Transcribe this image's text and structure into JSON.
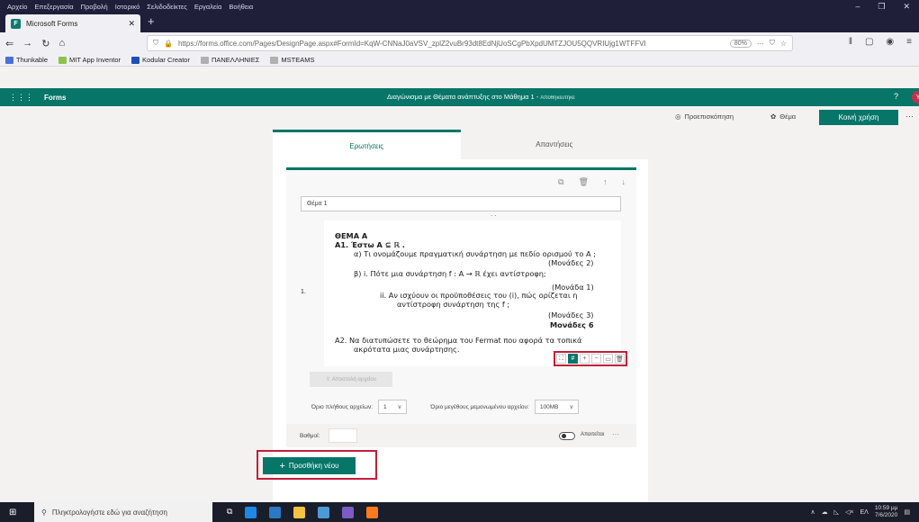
{
  "browser": {
    "menu": [
      "Αρχείο",
      "Επεξεργασία",
      "Προβολή",
      "Ιστορικό",
      "Σελιδοδείκτες",
      "Εργαλεία",
      "Βοήθεια"
    ],
    "tab_title": "Microsoft Forms",
    "url": "https://forms.office.com/Pages/DesignPage.aspx#FormId=KqW-CNNaJ0aVSV_zplZ2vuBr93dt8EdNjUoSCgPbXpdUMTZJOU5QQVRIUjg1WTFFVI",
    "url_host": "forms.office.com",
    "zoom": "80%",
    "bookmarks": [
      "Thunkable",
      "MIT App Inventor",
      "Kodular Creator",
      "ΠΑΝΕΛΛΗΝΙΕΣ",
      "MSTEAMS"
    ]
  },
  "forms": {
    "brand": "Forms",
    "doc_title": "Διαγώνισμα με Θέματα ανάπτυξης στο Μάθημα 1",
    "doc_status": "Αποθηκεύτηκε",
    "help": "?",
    "avatar": "Y",
    "preview": "Προεπισκόπηση",
    "theme": "Θέμα",
    "share": "Κοινή χρήση",
    "tabs": {
      "questions": "Ερωτήσεις",
      "responses": "Απαντήσεις"
    },
    "question": {
      "number": "1.",
      "title_value": "Θέμα 1",
      "image_text": {
        "heading": "ΘΕΜΑ Α",
        "a1": "Α1.  Έστω A ⊆ ℝ .",
        "a1a": "α)  Τι ονομάζουμε πραγματική συνάρτηση με πεδίο ορισμού το A ;",
        "a1a_marks": "(Μονάδες 2)",
        "a1bi": "β)  i.    Πότε μια συνάρτηση f : A → ℝ έχει αντίστροφη;",
        "a1bi_marks": "(Μονάδα 1)",
        "a1bii": "ii.  Αν  ισχύουν  οι  προϋποθέσεις  του  (i),  πώς  ορίζεται  η",
        "a1bii_cont": "αντίστροφη συνάρτηση της f ;",
        "a1bii_marks": "(Μονάδες 3)",
        "a1_total": "Μονάδες 6",
        "a2": "Α2.  Να  διατυπώσετε  το  θεώρημα  του  Fermat  που  αφορά  τα  τοπικά",
        "a2_cont": "ακρότατα μιας συνάρτησης."
      },
      "upload_label": "Αποστολή αρχείου",
      "file_count_label": "Όριο πλήθους αρχείων:",
      "file_count_value": "1",
      "file_size_label": "Όριο μεγέθους μεμονωμένου αρχείου:",
      "file_size_value": "100MB",
      "points_label": "Βαθμοί:",
      "points_value": "",
      "required_label": "Απαιτείται",
      "more": "···"
    },
    "add_new": "Προσθήκη νέου"
  },
  "taskbar": {
    "search_placeholder": "Πληκτρολογήστε εδώ για αναζήτηση",
    "lang": "ΕΛ",
    "time": "10:59 μμ",
    "date": "7/6/2020"
  }
}
